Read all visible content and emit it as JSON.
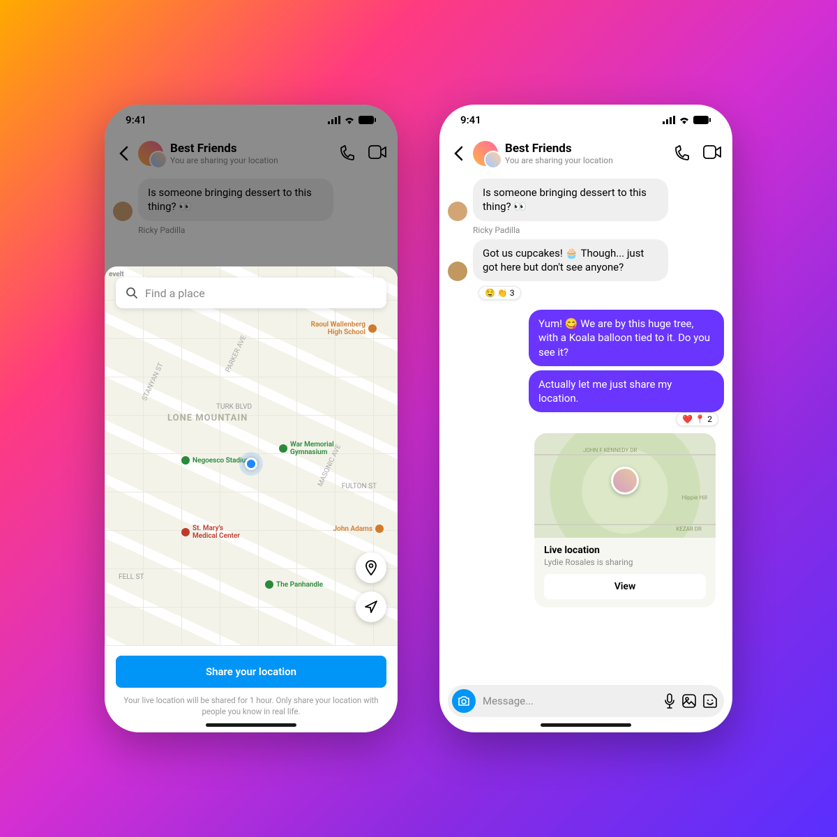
{
  "status": {
    "time": "9:41"
  },
  "header": {
    "title": "Best Friends",
    "subtitle": "You are sharing your location"
  },
  "phone1": {
    "msg1": "Is someone bringing dessert to this thing? 👀",
    "sender1": "Ricky Padilla",
    "search_placeholder": "Find a place",
    "map": {
      "district": "LONE MOUNTAIN",
      "poi_school": "Raoul Wallenberg High School",
      "poi_stadium": "Negoesco Stadiur",
      "poi_gym": "War Memorial Gymnasium",
      "poi_hospital": "St. Mary's Medical Center",
      "poi_adams": "John Adams",
      "poi_panhandle": "The Panhandle",
      "st_turk": "TURK BLVD",
      "st_fulton": "FULTON ST",
      "st_fell": "FELL ST",
      "st_stanyan": "STANYAN ST",
      "st_parker": "PARKER AVE",
      "st_masonic": "MASONIC AVE",
      "corner": "evelt"
    },
    "cta": "Share your location",
    "disclaimer": "Your live location will be shared for 1 hour. Only share your location with people you know in real life."
  },
  "phone2": {
    "msg1": "Is someone bringing dessert to this thing? 👀",
    "sender1": "Ricky Padilla",
    "msg2": "Got us cupcakes! 🧁 Though... just got here but don't see anyone?",
    "reaction2": "🤤 👏 3",
    "msg3": "Yum! 😋 We are by this huge tree, with a Koala balloon tied to it. Do you see it?",
    "msg4": "Actually let me just share my location.",
    "reaction4": "❤️ 📍 2",
    "location": {
      "title": "Live location",
      "subtitle": "Lydie Rosales is sharing",
      "button": "View",
      "map_label1": "JOHN F KENNEDY DR",
      "map_label2": "Hippie Hill",
      "map_label3": "KEZAR DR"
    },
    "composer": {
      "placeholder": "Message..."
    }
  }
}
